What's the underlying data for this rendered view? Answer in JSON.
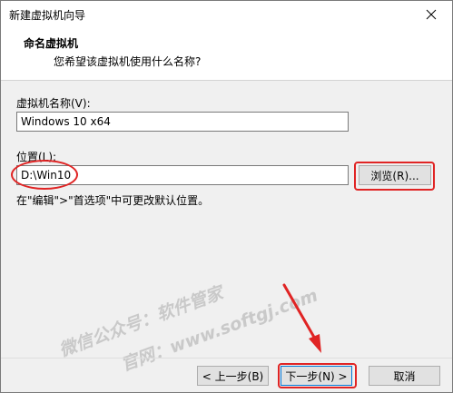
{
  "window": {
    "title": "新建虚拟机向导"
  },
  "header": {
    "title": "命名虚拟机",
    "subtitle": "您希望该虚拟机使用什么名称?"
  },
  "form": {
    "name_label": "虚拟机名称(V):",
    "name_value": "Windows 10 x64",
    "location_label": "位置(L):",
    "location_value": "D:\\Win10",
    "browse_label": "浏览(R)...",
    "hint": "在\"编辑\">\"首选项\"中可更改默认位置。"
  },
  "footer": {
    "back_label": "< 上一步(B)",
    "next_label": "下一步(N) >",
    "cancel_label": "取消"
  },
  "watermark": {
    "line1": "微信公众号：软件管家",
    "line2": "官网：www.softgj.com"
  },
  "annotations": {
    "highlight_color": "#e02424"
  }
}
